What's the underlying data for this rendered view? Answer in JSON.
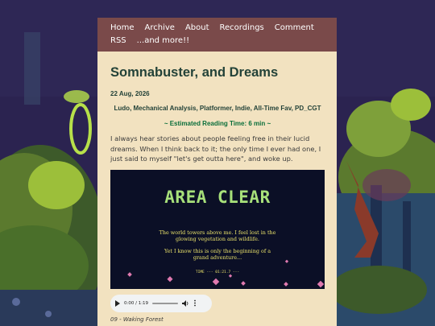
{
  "nav": {
    "row1": [
      "Home",
      "Archive",
      "About",
      "Recordings",
      "Comment"
    ],
    "row2": [
      "RSS",
      "...and more!!"
    ]
  },
  "post": {
    "title": "Somnabuster, and Dreams",
    "date": "22 Aug, 2026",
    "tags": "Ludo, Mechanical Analysis, Platformer, Indie, All-Time Fav, PD_CGT",
    "reading_time": "~ Estimated Reading Time: 6 min ~",
    "body": "I always hear stories about people feeling free in their lucid dreams. When I think back to it; the only time I ever had one, I just said to myself \"let's get outta here\", and woke up.",
    "image": {
      "heading": "AREA CLEAR",
      "line1": "The world towers above me. I feel lost in the",
      "line2": "glowing vegetation and wildlife.",
      "line3": "Yet I know this is only the beginning of a",
      "line4": "grand adventure...",
      "time": "TIME  ---  01:21.7  ---"
    },
    "audio": {
      "time": "0:00 / 1:19"
    },
    "caption": "09 - Waking Forest"
  },
  "colors": {
    "nav_bg": "#7a4a4a",
    "page_bg": "#f2e2c0",
    "title": "#234238",
    "reading": "#0a6e3a",
    "game_bg": "#0b0f26",
    "game_heading": "#a7e07a"
  }
}
